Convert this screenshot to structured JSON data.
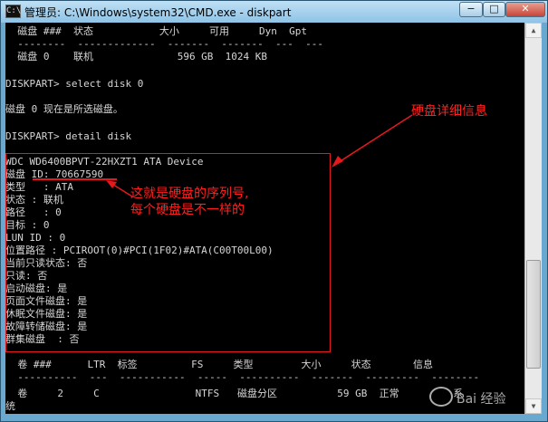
{
  "window": {
    "title": "管理员: C:\\Windows\\system32\\CMD.exe - diskpart",
    "minimize": "−",
    "maximize": "□",
    "close": "✕"
  },
  "console": {
    "lines": [
      {
        "text": "  磁盘 ###  状态           大小     可用     Dyn  Gpt"
      },
      {
        "text": "  --------  -------------  -------  -------  ---  ---"
      },
      {
        "text": "  磁盘 0    联机              596 GB  1024 KB"
      },
      {
        "text": ""
      },
      {
        "text": "DISKPART> select disk 0"
      },
      {
        "text": ""
      },
      {
        "text": "磁盘 0 现在是所选磁盘。"
      },
      {
        "text": ""
      },
      {
        "text": "DISKPART> detail disk"
      },
      {
        "text": ""
      },
      {
        "text": "WDC WD6400BPVT-22HXZT1 ATA Device"
      },
      {
        "text": "磁盘 ID: 70667590"
      },
      {
        "text": "类型   : ATA"
      },
      {
        "text": "状态 : 联机"
      },
      {
        "text": "路径   : 0"
      },
      {
        "text": "目标 : 0"
      },
      {
        "text": "LUN ID : 0"
      },
      {
        "text": "位置路径 : PCIROOT(0)#PCI(1F02)#ATA(C00T00L00)"
      },
      {
        "text": "当前只读状态: 否"
      },
      {
        "text": "只读: 否"
      },
      {
        "text": "启动磁盘: 是"
      },
      {
        "text": "页面文件磁盘: 是"
      },
      {
        "text": "休眠文件磁盘: 是"
      },
      {
        "text": "故障转储磁盘: 是"
      },
      {
        "text": "群集磁盘  : 否"
      },
      {
        "text": ""
      },
      {
        "text": "  卷 ###      LTR  标签         FS     类型        大小     状态       信息"
      },
      {
        "text": "  ----------  ---  -----------  -----  ----------  -------  ---------  --------"
      },
      {
        "text": "  卷     2     C                NTFS   磁盘分区          59 GB  正常         系"
      },
      {
        "text": "统"
      }
    ]
  },
  "annotations": {
    "top_label": "硬盘详细信息",
    "note_line1": "这就是硬盘的序列号,",
    "note_line2": "每个硬盘是不一样的",
    "color": "#e3191e"
  },
  "watermark": {
    "text": "Bai 经验"
  }
}
